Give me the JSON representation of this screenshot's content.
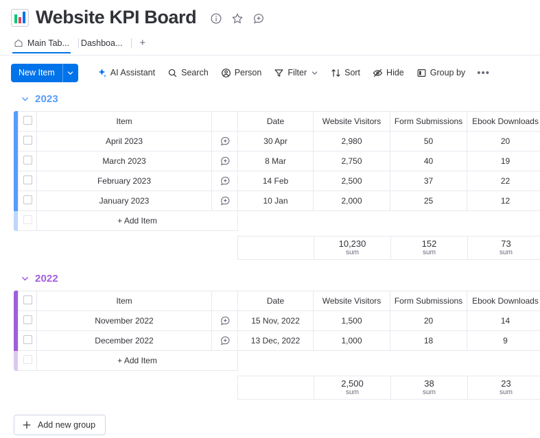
{
  "header": {
    "title": "Website KPI Board",
    "logo_icon": "bar-chart-icon",
    "logo_colors": [
      "#00c875",
      "#e2445c",
      "#0073ea"
    ],
    "icons": [
      {
        "name": "info-icon",
        "label": "Board info"
      },
      {
        "name": "star-icon",
        "label": "Add to favorites"
      },
      {
        "name": "add-comment-icon",
        "label": "Board updates"
      }
    ]
  },
  "tabs": {
    "items": [
      {
        "label": "Main Tab...",
        "icon": "home-icon",
        "active": true
      },
      {
        "label": "Dashboa...",
        "icon": "",
        "active": false
      }
    ],
    "add_label": "+"
  },
  "toolbar": {
    "new_item_label": "New Item",
    "new_item_caret": "chevron-down-icon",
    "items": [
      {
        "label": "AI Assistant",
        "icon": "ai-sparkle-icon",
        "caret": false
      },
      {
        "label": "Search",
        "icon": "search-icon",
        "caret": false
      },
      {
        "label": "Person",
        "icon": "person-icon",
        "caret": false
      },
      {
        "label": "Filter",
        "icon": "filter-icon",
        "caret": true
      },
      {
        "label": "Sort",
        "icon": "sort-icon",
        "caret": false
      },
      {
        "label": "Hide",
        "icon": "hide-eye-icon",
        "caret": false
      },
      {
        "label": "Group by",
        "icon": "group-by-icon",
        "caret": false
      }
    ],
    "more_label": "•••"
  },
  "columns": {
    "item": "Item",
    "date": "Date",
    "visitors": "Website Visitors",
    "forms": "Form Submissions",
    "ebooks": "Ebook Downloads"
  },
  "add_item_label": "+ Add Item",
  "sum_label": "sum",
  "groups": [
    {
      "title": "2023",
      "color": "#579bfc",
      "color_light": "#bdd6fd",
      "rows": [
        {
          "item": "April 2023",
          "date": "30 Apr",
          "visitors": "2,980",
          "forms": "50",
          "ebooks": "20"
        },
        {
          "item": "March 2023",
          "date": "8 Mar",
          "visitors": "2,750",
          "forms": "40",
          "ebooks": "19"
        },
        {
          "item": "February 2023",
          "date": "14 Feb",
          "visitors": "2,500",
          "forms": "37",
          "ebooks": "22"
        },
        {
          "item": "January 2023",
          "date": "10 Jan",
          "visitors": "2,000",
          "forms": "25",
          "ebooks": "12"
        }
      ],
      "summary": {
        "visitors": "10,230",
        "forms": "152",
        "ebooks": "73"
      }
    },
    {
      "title": "2022",
      "color": "#a25ddc",
      "color_light": "#ddc7f0",
      "rows": [
        {
          "item": "November 2022",
          "date": "15 Nov, 2022",
          "visitors": "1,500",
          "forms": "20",
          "ebooks": "14"
        },
        {
          "item": "December 2022",
          "date": "13 Dec, 2022",
          "visitors": "1,000",
          "forms": "18",
          "ebooks": "9"
        }
      ],
      "summary": {
        "visitors": "2,500",
        "forms": "38",
        "ebooks": "23"
      }
    }
  ],
  "footer": {
    "add_group_label": "Add new group",
    "add_group_icon": "plus-icon"
  }
}
